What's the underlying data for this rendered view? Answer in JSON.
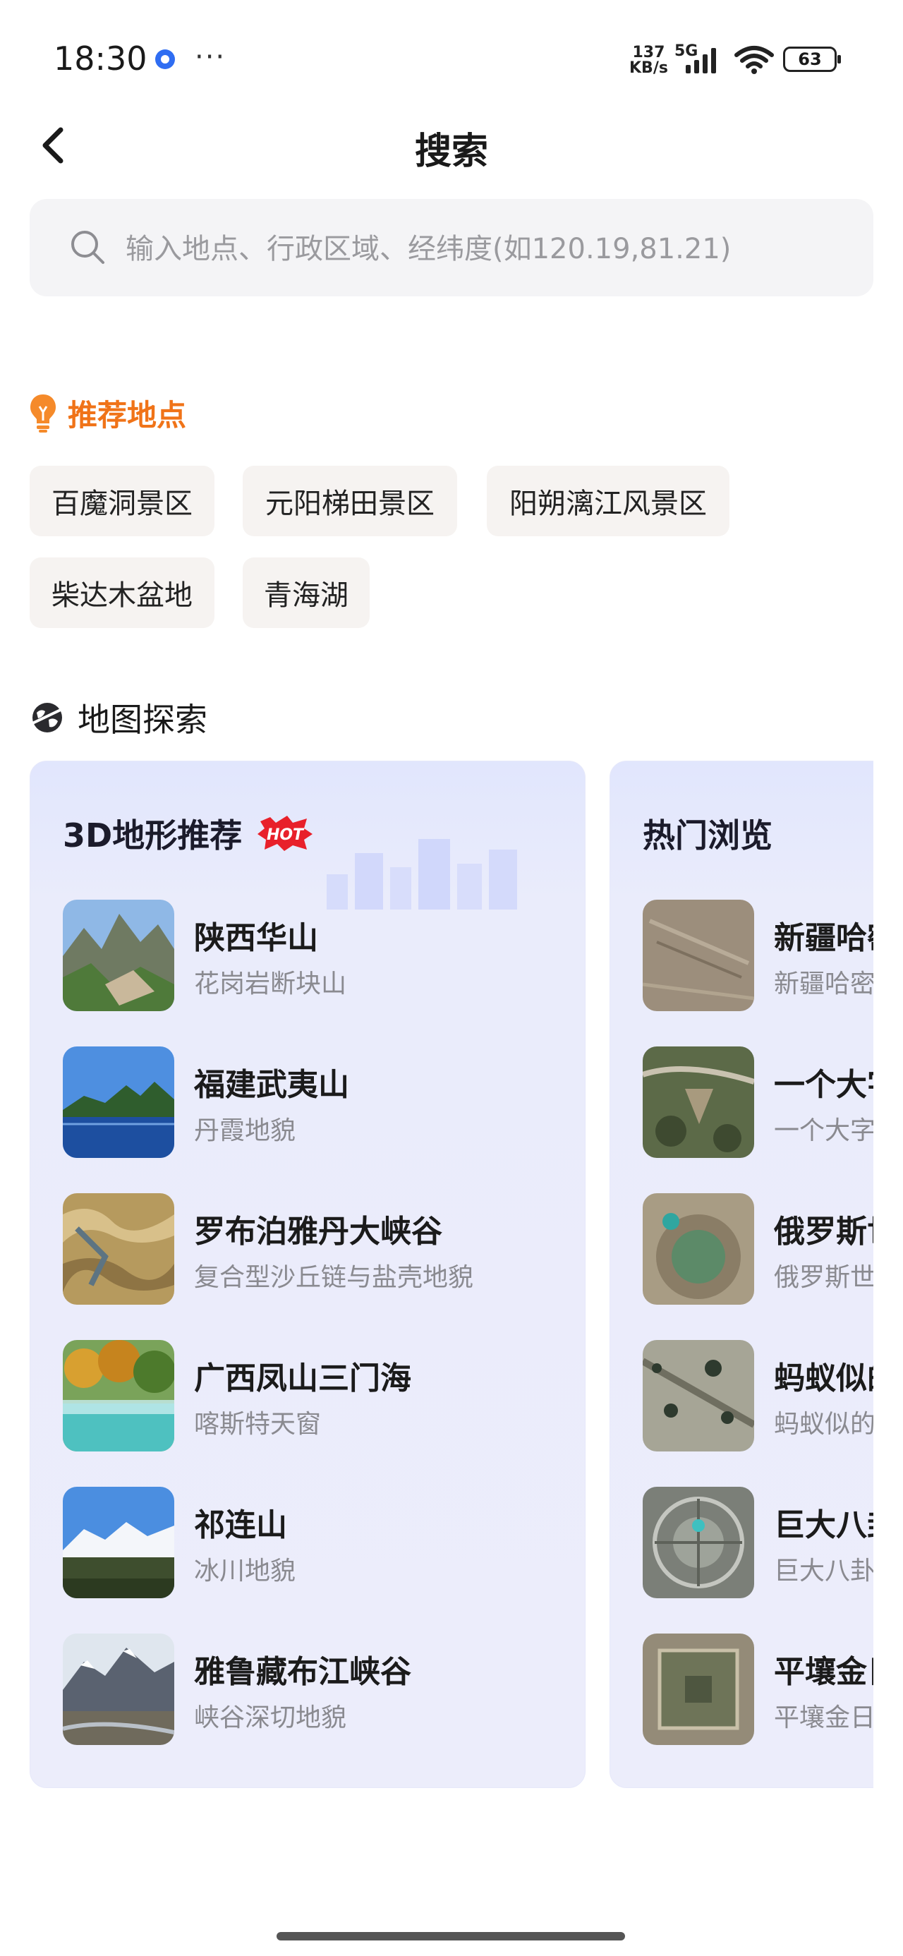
{
  "status_bar": {
    "time": "18:30",
    "more": "···",
    "net_speed_value": "137",
    "net_speed_unit": "KB/s",
    "network": "5G",
    "battery": "63"
  },
  "header": {
    "title": "搜索"
  },
  "search": {
    "placeholder": "输入地点、行政区域、经纬度(如120.19,81.21)"
  },
  "recommended": {
    "title": "推荐地点",
    "items": [
      "百魔洞景区",
      "元阳梯田景区",
      "阳朔漓江风景区",
      "柴达木盆地",
      "青海湖"
    ]
  },
  "explore": {
    "title": "地图探索",
    "cards": [
      {
        "title": "3D地形推荐",
        "badge": "HOT",
        "items": [
          {
            "name": "陕西华山",
            "desc": "花岗岩断块山"
          },
          {
            "name": "福建武夷山",
            "desc": "丹霞地貌"
          },
          {
            "name": "罗布泊雅丹大峡谷",
            "desc": "复合型沙丘链与盐壳地貌"
          },
          {
            "name": "广西凤山三门海",
            "desc": "喀斯特天窗"
          },
          {
            "name": "祁连山",
            "desc": "冰川地貌"
          },
          {
            "name": "雅鲁藏布江峡谷",
            "desc": "峡谷深切地貌"
          }
        ]
      },
      {
        "title": "热门浏览",
        "items": [
          {
            "name": "新疆哈密",
            "desc": "新疆哈密"
          },
          {
            "name": "一个大字",
            "desc": "一个大字"
          },
          {
            "name": "俄罗斯世",
            "desc": "俄罗斯世"
          },
          {
            "name": "蚂蚁似的",
            "desc": "蚂蚁似的"
          },
          {
            "name": "巨大八卦",
            "desc": "巨大八卦"
          },
          {
            "name": "平壤金日",
            "desc": "平壤金日"
          }
        ]
      }
    ]
  },
  "colors": {
    "accent_orange": "#f07318",
    "card_bg": "#eceefb",
    "chip_bg": "#f6f3f1",
    "hot_red": "#e8202a"
  }
}
